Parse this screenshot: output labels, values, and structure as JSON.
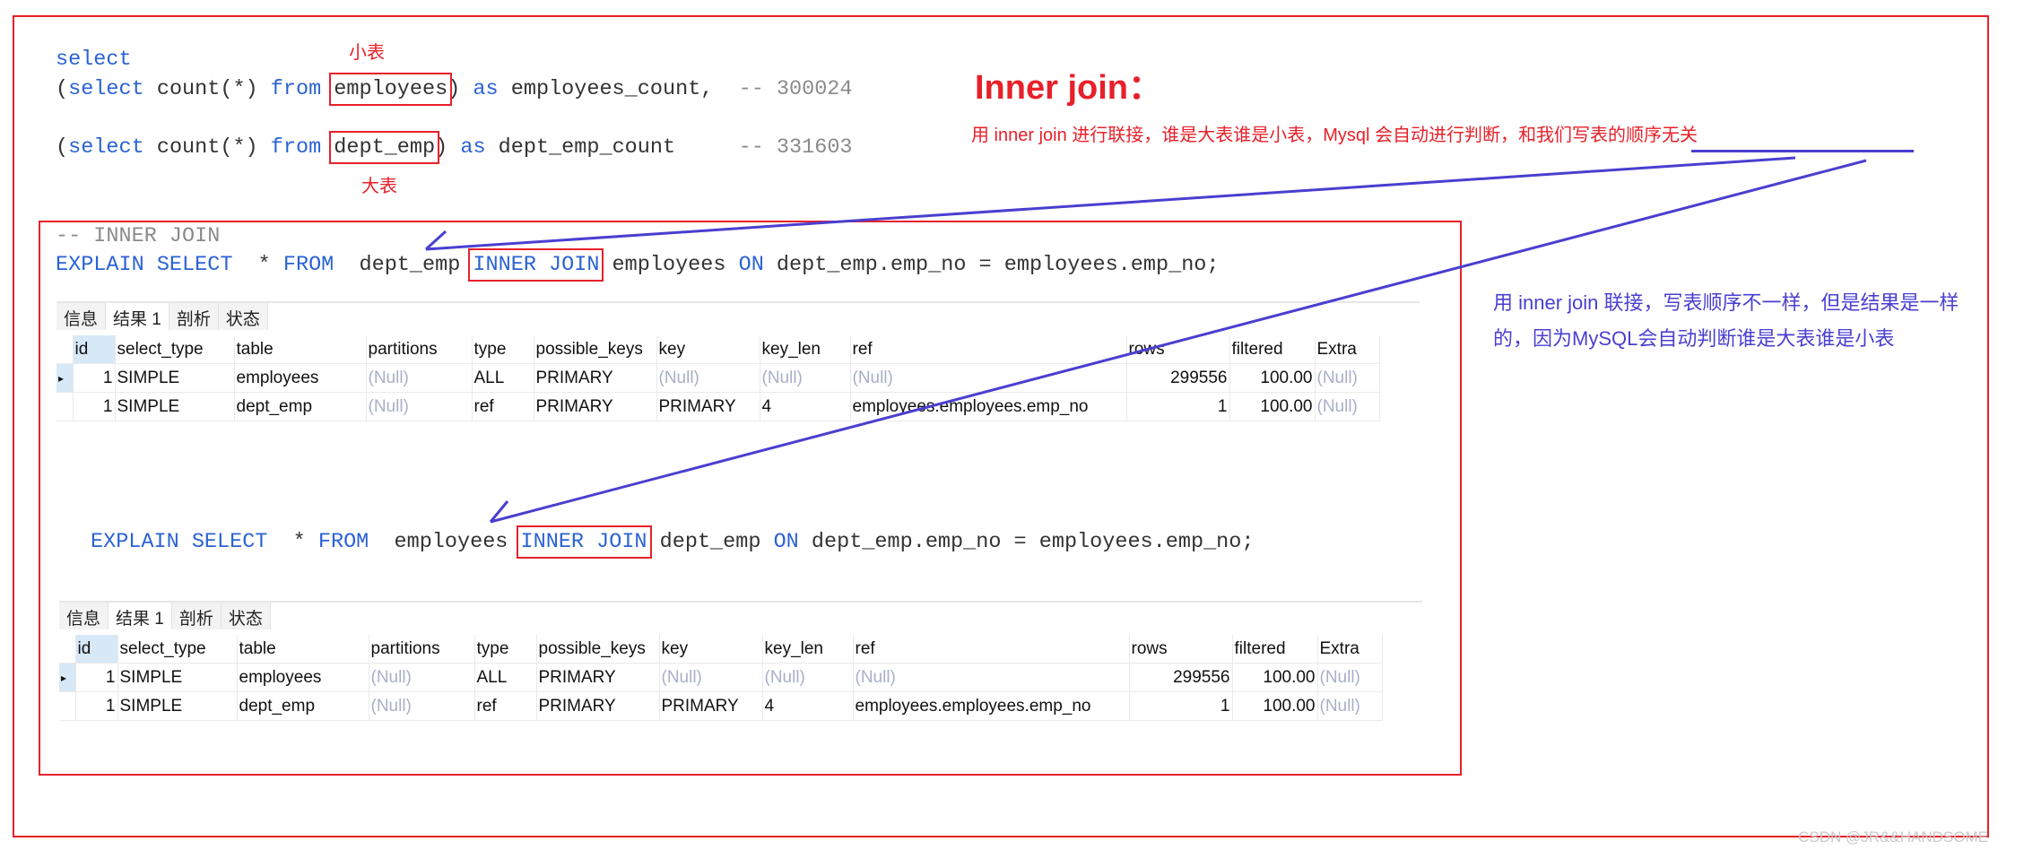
{
  "query1": {
    "select": "select",
    "line1": {
      "open": "(",
      "select": "select",
      "count": " count(*) ",
      "from": "from",
      "table": "employees",
      "close": ")",
      "as": " as",
      "alias": " employees_count,",
      "comment": "  -- 300024"
    },
    "line2": {
      "open": "(",
      "select": "select",
      "count": " count(*) ",
      "from": "from",
      "table": "dept_emp",
      "close": ")",
      "as": " as",
      "alias": " dept_emp_count",
      "comment": "     -- 331603"
    },
    "small_label": "小表",
    "big_label": "大表"
  },
  "heading": "Inner join：",
  "subtitle_main": "用 inner join 进行联接，谁是大表谁是小表，Mysql 会自动进行判断，",
  "subtitle_underlined": "和我们写表的顺序无关",
  "side_note": "用 inner join 联接，写表顺序不一样，但是结果是一样的，因为MySQL会自动判断谁是大表谁是小表",
  "explain1": {
    "comment": "-- INNER JOIN",
    "explain_select": "EXPLAIN SELECT",
    "star": "  * ",
    "from": "FROM",
    "t1": "  dept_emp ",
    "join": "INNER JOIN",
    "t2": " employees ",
    "on": "ON",
    "cond": " dept_emp.emp_no = employees.emp_no;"
  },
  "explain2": {
    "explain_select": "EXPLAIN SELECT",
    "star": "  * ",
    "from": "FROM",
    "t1": "  employees ",
    "join": "INNER JOIN",
    "t2": " dept_emp ",
    "on": "ON",
    "cond": " dept_emp.emp_no = employees.emp_no;"
  },
  "tabs": [
    "信息",
    "结果 1",
    "剖析",
    "状态"
  ],
  "active_tab": "结果 1",
  "columns": [
    "id",
    "select_type",
    "table",
    "partitions",
    "type",
    "possible_keys",
    "key",
    "key_len",
    "ref",
    "rows",
    "filtered",
    "Extra"
  ],
  "rows": [
    [
      "1",
      "SIMPLE",
      "employees",
      "(Null)",
      "ALL",
      "PRIMARY",
      "(Null)",
      "(Null)",
      "(Null)",
      "299556",
      "100.00",
      "(Null)"
    ],
    [
      "1",
      "SIMPLE",
      "dept_emp",
      "(Null)",
      "ref",
      "PRIMARY",
      "PRIMARY",
      "4",
      "employees.employees.emp_no",
      "1",
      "100.00",
      "(Null)"
    ]
  ],
  "watermark": "CSDN @JR&&HANDSOME",
  "colors": {
    "annotation_red": "#e8202a",
    "arrow_blue": "#4a3fd0",
    "keyword_blue": "#2a62d4"
  }
}
